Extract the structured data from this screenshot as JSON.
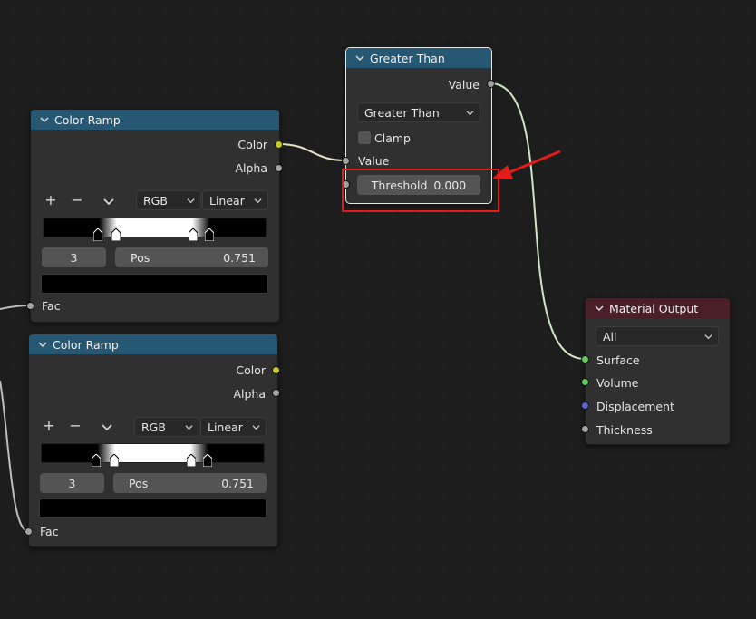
{
  "greater_than": {
    "title": "Greater Than",
    "output_value": "Value",
    "operation": "Greater Than",
    "clamp_label": "Clamp",
    "input_value": "Value",
    "threshold_label": "Threshold",
    "threshold_value": "0.000"
  },
  "color_ramp_1": {
    "title": "Color Ramp",
    "color_label": "Color",
    "alpha_label": "Alpha",
    "add": "+",
    "remove": "−",
    "color_mode": "RGB",
    "interpolation": "Linear",
    "index": "3",
    "pos_label": "Pos",
    "pos_value": "0.751",
    "fac_label": "Fac"
  },
  "color_ramp_2": {
    "title": "Color Ramp",
    "color_label": "Color",
    "alpha_label": "Alpha",
    "add": "+",
    "remove": "−",
    "color_mode": "RGB",
    "interpolation": "Linear",
    "index": "3",
    "pos_label": "Pos",
    "pos_value": "0.751",
    "fac_label": "Fac"
  },
  "material_output": {
    "title": "Material Output",
    "target": "All",
    "surface": "Surface",
    "volume": "Volume",
    "displacement": "Displacement",
    "thickness": "Thickness"
  },
  "colors": {
    "header_blue": "#275873",
    "header_red": "#4a1f28",
    "annotation": "#e31b1b",
    "socket_yellow": "#c7c729",
    "socket_green": "#63c763",
    "socket_grey": "#a1a1a1",
    "socket_blue": "#6363c7"
  }
}
